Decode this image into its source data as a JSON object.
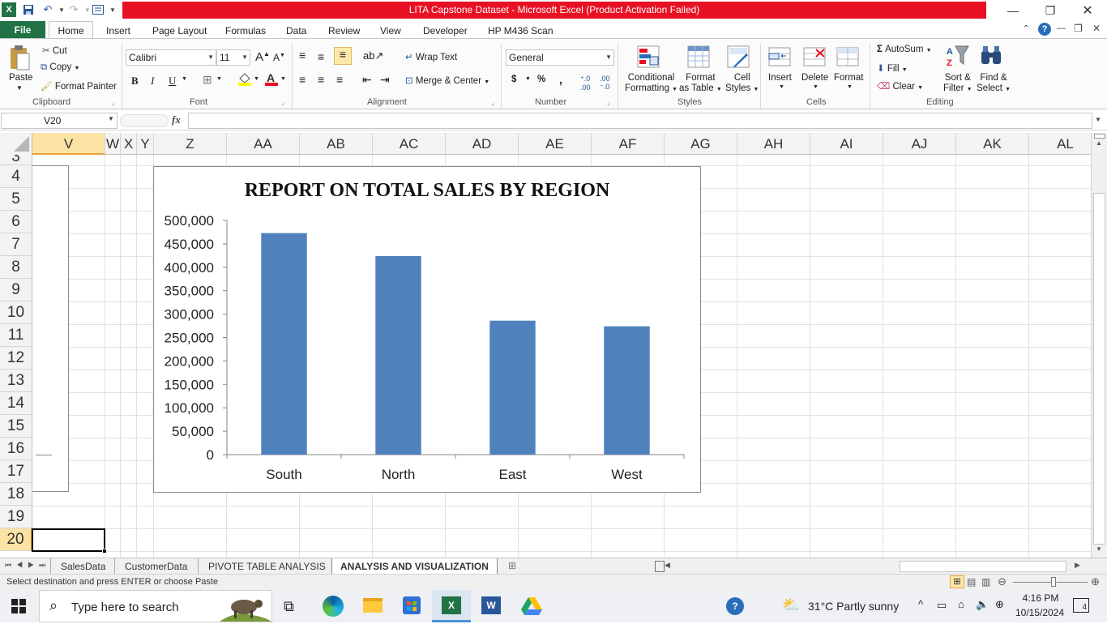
{
  "window": {
    "title": "LITA Capstone Dataset  -  Microsoft Excel (Product Activation Failed)"
  },
  "tabs": [
    "File",
    "Home",
    "Insert",
    "Page Layout",
    "Formulas",
    "Data",
    "Review",
    "View",
    "Developer",
    "HP M436 Scan"
  ],
  "ribbon": {
    "clipboard": {
      "paste": "Paste",
      "cut": "Cut",
      "copy": "Copy",
      "format_painter": "Format Painter",
      "label": "Clipboard"
    },
    "font": {
      "name": "Calibri",
      "size": "11",
      "label": "Font",
      "bold": "B",
      "italic": "I",
      "underline": "U"
    },
    "alignment": {
      "wrap_text": "Wrap Text",
      "merge_center": "Merge & Center",
      "label": "Alignment"
    },
    "number": {
      "format": "General",
      "currency": "$",
      "percent": "%",
      "comma": ",",
      "label": "Number"
    },
    "styles": {
      "conditional": "Conditional",
      "conditional2": "Formatting",
      "format_as": "Format",
      "format_as2": "as Table",
      "cell_styles": "Cell",
      "cell_styles2": "Styles",
      "label": "Styles"
    },
    "cells": {
      "insert": "Insert",
      "delete": "Delete",
      "format": "Format",
      "label": "Cells"
    },
    "editing": {
      "autosum": "AutoSum",
      "fill": "Fill",
      "clear": "Clear",
      "sort": "Sort &",
      "sort2": "Filter",
      "find": "Find &",
      "find2": "Select",
      "label": "Editing"
    }
  },
  "formula_bar": {
    "name_box": "V20",
    "fx": "fx",
    "value": ""
  },
  "columns": [
    "V",
    "W",
    "X",
    "Y",
    "Z",
    "AA",
    "AB",
    "AC",
    "AD",
    "AE",
    "AF",
    "AG",
    "AH",
    "AI",
    "AJ",
    "AK",
    "AL"
  ],
  "rows": [
    "3",
    "4",
    "5",
    "6",
    "7",
    "8",
    "9",
    "10",
    "11",
    "12",
    "13",
    "14",
    "15",
    "16",
    "17",
    "18",
    "19",
    "20"
  ],
  "chart_data": {
    "type": "bar",
    "title": "REPORT ON TOTAL SALES BY REGION",
    "categories": [
      "South",
      "North",
      "East",
      "West"
    ],
    "values": [
      473000,
      424000,
      286000,
      274000
    ],
    "ylim": [
      0,
      500000
    ],
    "yticks": [
      "0",
      "50,000",
      "100,000",
      "150,000",
      "200,000",
      "250,000",
      "300,000",
      "350,000",
      "400,000",
      "450,000",
      "500,000"
    ],
    "grid": false,
    "bar_color": "#4f81bd"
  },
  "sheets": [
    "SalesData",
    "CustomerData",
    "PIVOTE TABLE ANALYSIS",
    "ANALYSIS AND VISUALIZATION"
  ],
  "status": {
    "message": "Select destination and press ENTER or choose Paste"
  },
  "taskbar": {
    "search_placeholder": "Type here to search",
    "weather": "31°C  Partly sunny",
    "time": "4:16 PM",
    "date": "10/15/2024",
    "notifications": "4"
  }
}
